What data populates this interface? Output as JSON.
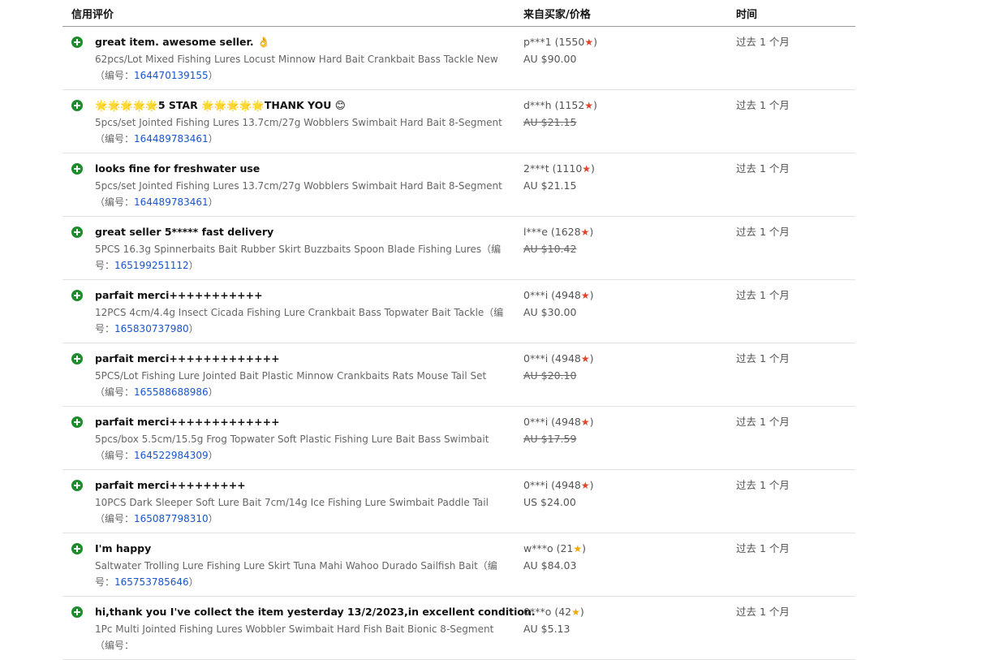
{
  "header": {
    "col_feedback": "信用评价",
    "col_buyer_price": "来自买家/价格",
    "col_time": "时间"
  },
  "rows": [
    {
      "comment": "great item. awesome seller. 👌",
      "item_text": "62pcs/Lot Mixed Fishing Lures Locust Minnow Hard Bait Crankbait Bass Tackle New（编号：",
      "item_id": "164470139155",
      "item_close": "）",
      "buyer": "p***1",
      "score": "1550",
      "star_color": "red",
      "price": "AU $90.00",
      "price_struck": false,
      "time": "过去 1 个月"
    },
    {
      "comment": "🌟🌟🌟🌟🌟5 STAR 🌟🌟🌟🌟🌟THANK YOU 😊",
      "item_text": "5pcs/set Jointed Fishing Lures 13.7cm/27g Wobblers Swimbait Hard Bait 8-Segment（编号：",
      "item_id": "164489783461",
      "item_close": "）",
      "buyer": "d***h",
      "score": "1152",
      "star_color": "red",
      "price": "AU $21.15",
      "price_struck": true,
      "time": "过去 1 个月"
    },
    {
      "comment": "looks fine for freshwater use",
      "item_text": "5pcs/set Jointed Fishing Lures 13.7cm/27g Wobblers Swimbait Hard Bait 8-Segment（编号：",
      "item_id": "164489783461",
      "item_close": "）",
      "buyer": "2***t",
      "score": "1110",
      "star_color": "red",
      "price": "AU $21.15",
      "price_struck": false,
      "time": "过去 1 个月"
    },
    {
      "comment": "great seller 5***** fast delivery",
      "item_text": "5PCS 16.3g Spinnerbaits Bait Rubber Skirt Buzzbaits Spoon Blade Fishing Lures（编号：",
      "item_id": "165199251112",
      "item_close": "）",
      "buyer": "l***e",
      "score": "1628",
      "star_color": "red",
      "price": "AU $10.42",
      "price_struck": true,
      "time": "过去 1 个月"
    },
    {
      "comment": "parfait merci+++++++++++",
      "item_text": "12PCS 4cm/4.4g Insect Cicada Fishing Lure Crankbait Bass Topwater Bait Tackle（编号：",
      "item_id": "165830737980",
      "item_close": "）",
      "buyer": "0***i",
      "score": "4948",
      "star_color": "red",
      "price": "AU $30.00",
      "price_struck": false,
      "time": "过去 1 个月"
    },
    {
      "comment": "parfait merci+++++++++++++",
      "item_text": "5PCS/Lot Fishing Lure Jointed Bait Plastic Minnow Crankbaits Rats Mouse Tail Set（编号：",
      "item_id": "165588688986",
      "item_close": "）",
      "buyer": "0***i",
      "score": "4948",
      "star_color": "red",
      "price": "AU $20.10",
      "price_struck": true,
      "time": "过去 1 个月"
    },
    {
      "comment": "parfait merci+++++++++++++",
      "item_text": "5pcs/box 5.5cm/15.5g Frog Topwater Soft Plastic Fishing Lure Bait Bass Swimbait（编号：",
      "item_id": "164522984309",
      "item_close": "）",
      "buyer": "0***i",
      "score": "4948",
      "star_color": "red",
      "price": "AU $17.59",
      "price_struck": true,
      "time": "过去 1 个月"
    },
    {
      "comment": "parfait merci+++++++++",
      "item_text": "10PCS Dark Sleeper Soft Lure Bait 7cm/14g Ice Fishing Lure Swimbait Paddle Tail（编号：",
      "item_id": "165087798310",
      "item_close": "）",
      "buyer": "0***i",
      "score": "4948",
      "star_color": "red",
      "price": "US $24.00",
      "price_struck": false,
      "time": "过去 1 个月"
    },
    {
      "comment": "I'm happy",
      "item_text": "Saltwater Trolling Lure Fishing Lure Skirt Tuna Mahi Wahoo Durado Sailfish Bait（编号：",
      "item_id": "165753785646",
      "item_close": "）",
      "buyer": "w***o",
      "score": "21",
      "star_color": "gold",
      "price": "AU $84.03",
      "price_struck": false,
      "time": "过去 1 个月"
    },
    {
      "comment": "hi,thank you I've collect the item yesterday 13/2/2023,in excellent condition.",
      "item_text": "1Pc Multi Jointed Fishing Lures Wobbler Swimbait Hard Fish Bait Bionic 8-Segment（编号：",
      "item_id": "",
      "item_close": "",
      "buyer": "0***o",
      "score": "42",
      "star_color": "gold",
      "price": "AU $5.13",
      "price_struck": false,
      "time": "过去 1 个月"
    }
  ]
}
